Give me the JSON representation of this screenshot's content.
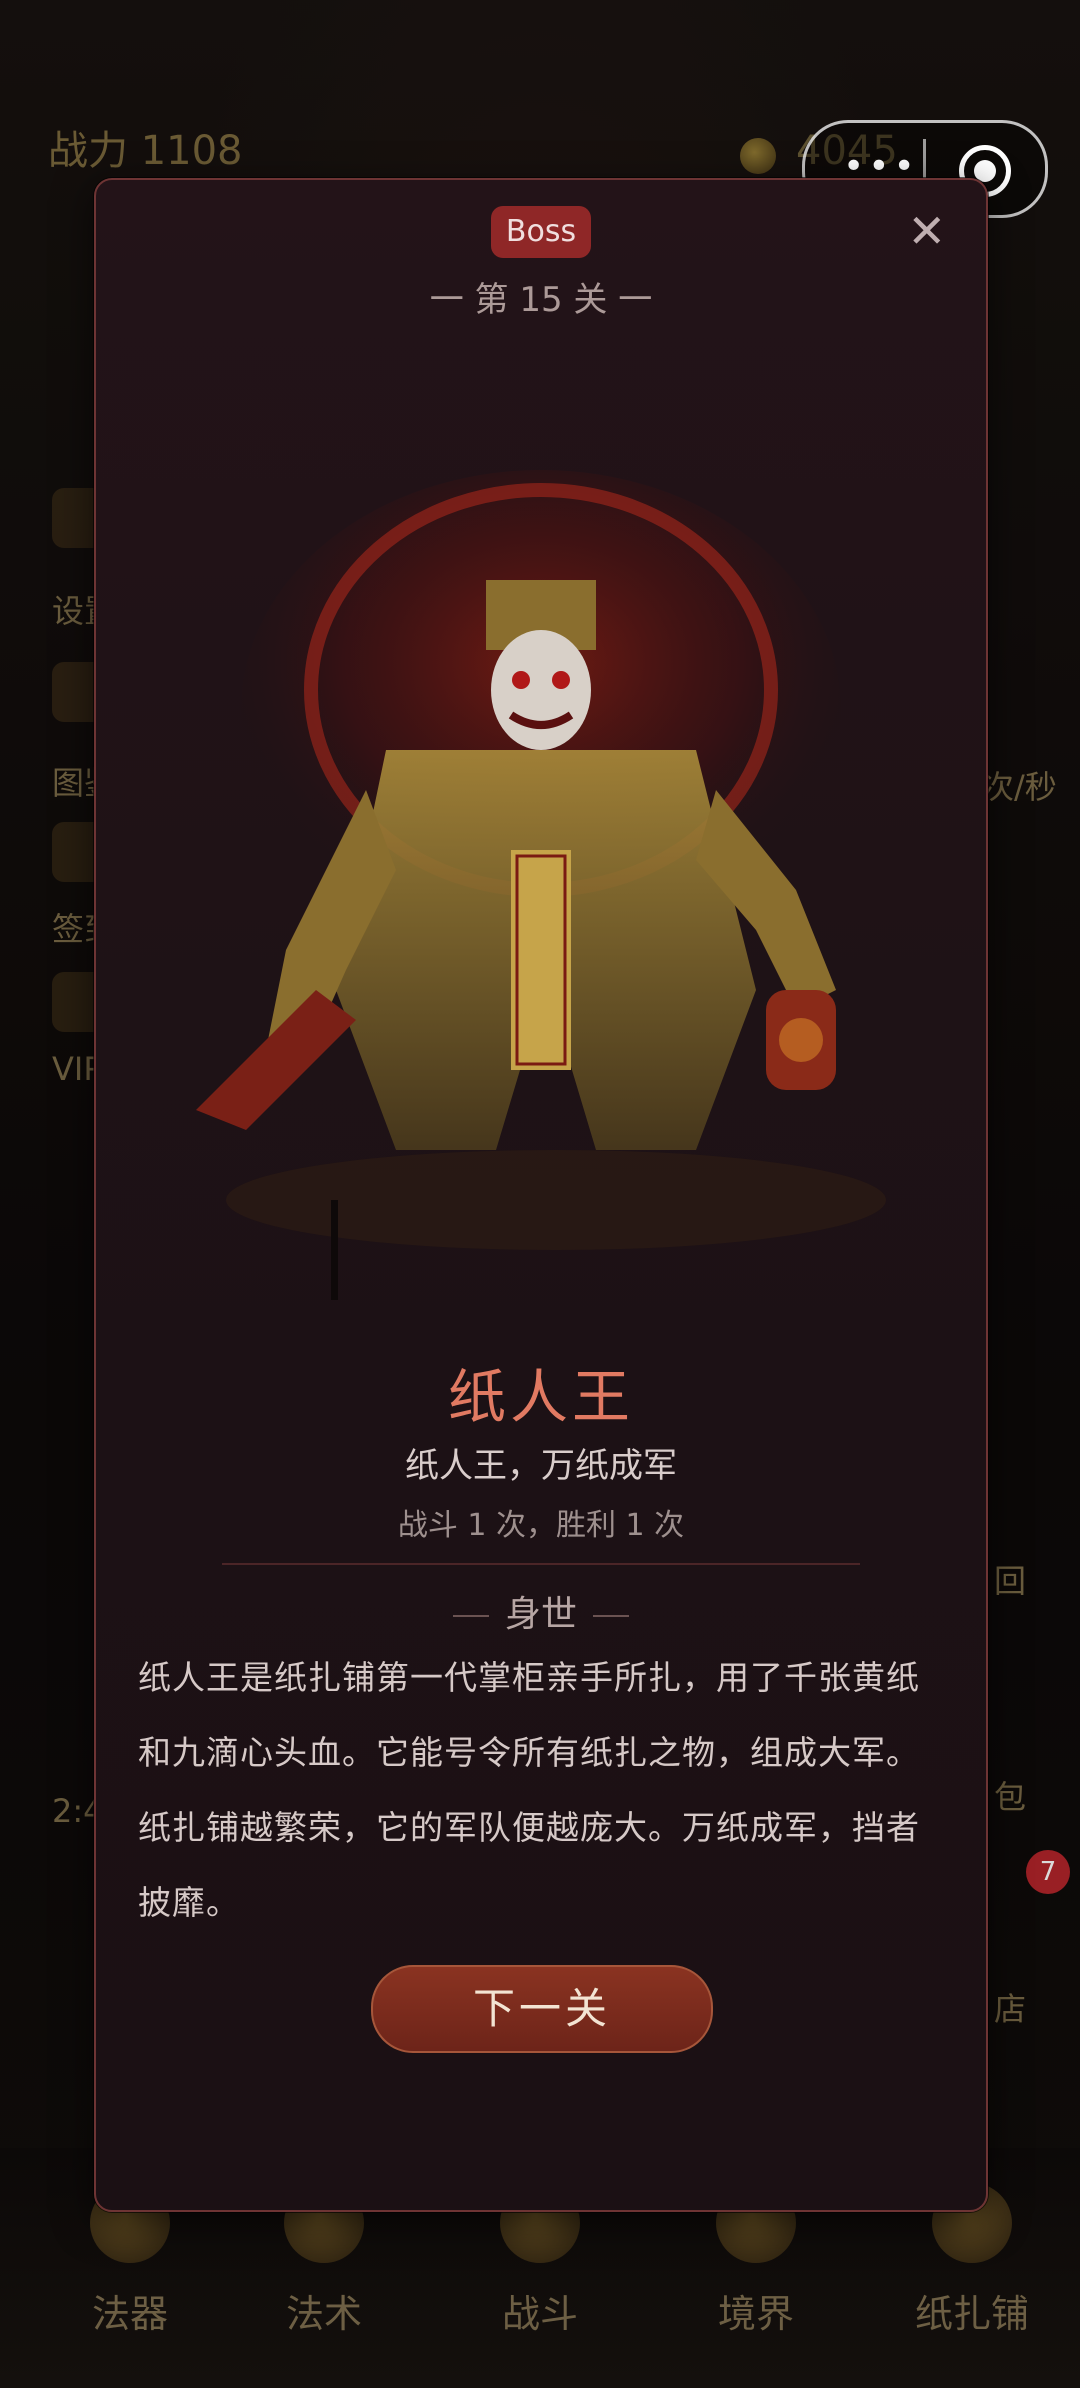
{
  "background": {
    "power": "战力 1108",
    "coins": "4045",
    "sidebar_left": [
      "设置",
      "图鉴",
      "签到",
      "VIP"
    ],
    "time": "2:4",
    "sidebar_right": [
      "次/秒",
      "回",
      "包",
      "店"
    ],
    "notification_count": "7"
  },
  "capsule": {
    "menu_icon": "more-dots-icon",
    "close_icon": "target-icon"
  },
  "modal": {
    "badge": "Boss",
    "stage": "一 第 15 关 一",
    "close": "✕",
    "boss_name": "纸人王",
    "boss_title": "纸人王，万纸成军",
    "record": "战斗 1 次，胜利 1 次",
    "section_title": "身世",
    "lore": "纸人王是纸扎铺第一代掌柜亲手所扎，用了千张黄纸和九滴心头血。它能号令所有纸扎之物，组成大军。纸扎铺越繁荣，它的军队便越庞大。万纸成军，挡者披靡。",
    "next_button": "下一关"
  },
  "nav": [
    {
      "label": "法器",
      "icon": "artifact-icon"
    },
    {
      "label": "法术",
      "icon": "spell-icon"
    },
    {
      "label": "战斗",
      "icon": "battle-icon"
    },
    {
      "label": "境界",
      "icon": "realm-icon"
    },
    {
      "label": "纸扎铺",
      "icon": "paper-shop-icon"
    }
  ],
  "colors": {
    "accent": "#e17a62",
    "button": "#7a2a1c",
    "border": "#6e3434"
  }
}
